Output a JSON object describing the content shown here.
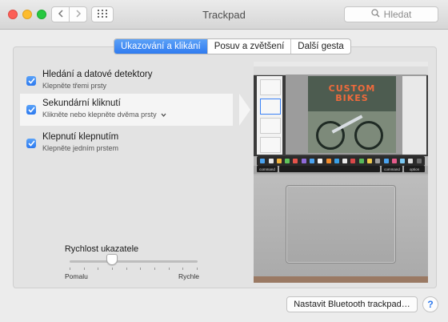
{
  "window": {
    "title": "Trackpad"
  },
  "toolbar": {
    "back_icon": "chevron-left-icon",
    "forward_icon": "chevron-right-icon",
    "grid_icon": "grid-icon",
    "search_placeholder": "Hledat",
    "search_icon": "search-icon"
  },
  "tabs": [
    {
      "label": "Ukazování a klikání",
      "active": true
    },
    {
      "label": "Posuv a zvětšení",
      "active": false
    },
    {
      "label": "Další gesta",
      "active": false
    }
  ],
  "options": [
    {
      "title": "Hledání a datové detektory",
      "subtitle": "Klepněte třemi prsty",
      "checked": true,
      "selected": false
    },
    {
      "title": "Sekundární kliknutí",
      "subtitle": "Klikněte nebo klepněte dvěma prsty",
      "checked": true,
      "selected": true,
      "has_dropdown": true
    },
    {
      "title": "Klepnutí klepnutím",
      "subtitle": "Klepněte jedním prstem",
      "checked": true,
      "selected": false
    }
  ],
  "pointer_speed": {
    "label": "Rychlost ukazatele",
    "min_label": "Pomalu",
    "max_label": "Rychle",
    "value": 0.33
  },
  "preview": {
    "headline": "CUSTOM BIKES",
    "key_left": "command",
    "key_right_1": "command",
    "key_right_2": "option"
  },
  "footer": {
    "bluetooth_button": "Nastavit Bluetooth trackpad…",
    "help_label": "?"
  },
  "colors": {
    "accent": "#2f7bf0",
    "close": "#fc5f57",
    "minimize": "#fdbc2e",
    "zoom": "#27c840"
  }
}
